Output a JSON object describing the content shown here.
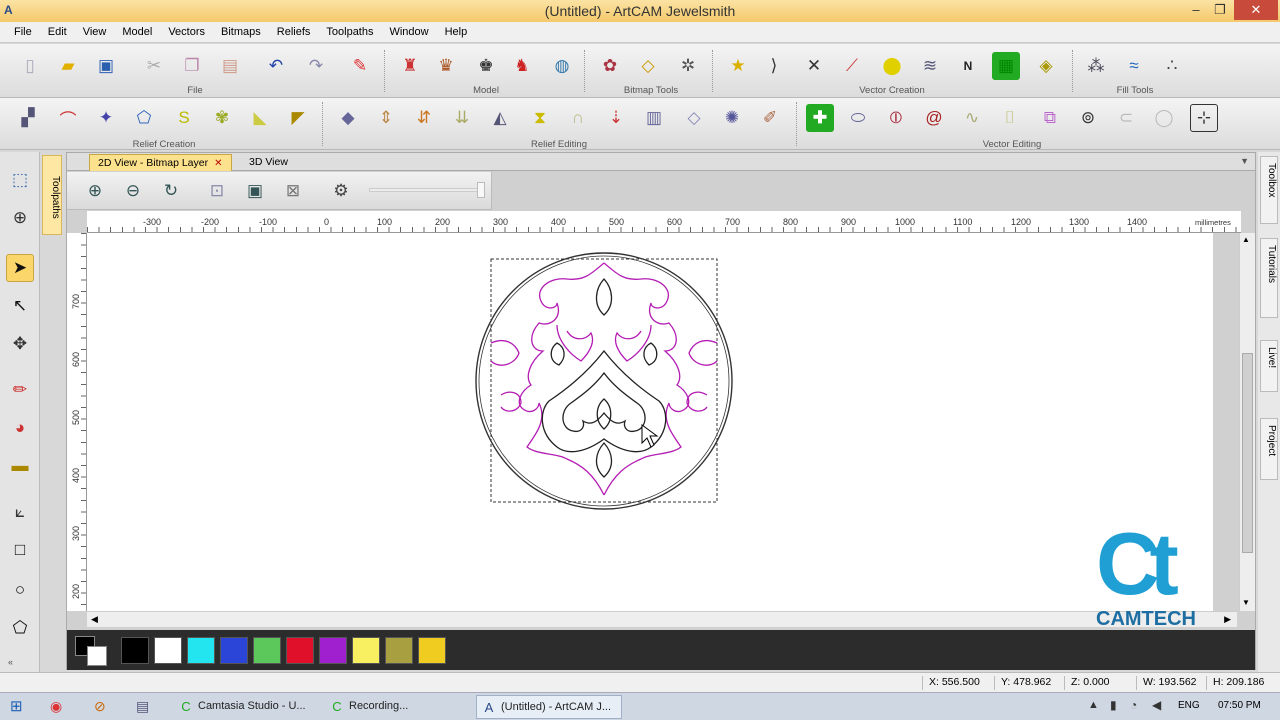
{
  "window": {
    "title": "(Untitled) - ArtCAM Jewelsmith",
    "min": "–",
    "max": "❐",
    "close": "✕"
  },
  "menu": [
    "File",
    "Edit",
    "View",
    "Model",
    "Vectors",
    "Bitmaps",
    "Reliefs",
    "Toolpaths",
    "Window",
    "Help"
  ],
  "toolbar1": {
    "groups": [
      "File",
      "Model",
      "Bitmap Tools",
      "Vector Creation",
      "Fill Tools"
    ]
  },
  "toolbar2": {
    "groups": [
      "Relief Creation",
      "Relief Editing",
      "Vector Editing"
    ]
  },
  "left_tab": "Toolpaths",
  "view_tabs": [
    {
      "label": "2D View - Bitmap Layer",
      "close": "✕"
    },
    {
      "label": "3D View"
    }
  ],
  "ruler": {
    "units": "millimetres",
    "h_ticks": [
      "-300",
      "-200",
      "-100",
      "0",
      "100",
      "200",
      "300",
      "400",
      "500",
      "600",
      "700",
      "800",
      "900",
      "1000",
      "1100",
      "1200",
      "1300",
      "1400"
    ],
    "v_ticks": [
      "700",
      "600",
      "500",
      "400",
      "300",
      "200"
    ]
  },
  "palette": {
    "colors": [
      "#000000",
      "#ffffff",
      "#22e5f0",
      "#2a45d8",
      "#5cc85c",
      "#e0102a",
      "#a020d0",
      "#f8f060",
      "#a8a040",
      "#f0cc20"
    ]
  },
  "right_tabs": [
    "Toolbox",
    "Tutorials",
    "Live!",
    "Project"
  ],
  "status": {
    "x": "X: 556.500",
    "y": "Y: 478.962",
    "z": "Z: 0.000",
    "w": "W: 193.562",
    "h": "H: 209.186"
  },
  "taskbar": {
    "items": [
      "Camtasia Studio - U...",
      "Recording...",
      "(Untitled) - ArtCAM J..."
    ],
    "lang": "ENG",
    "time": "07:50 PM"
  },
  "watermark": {
    "text": "CAMTECH"
  }
}
